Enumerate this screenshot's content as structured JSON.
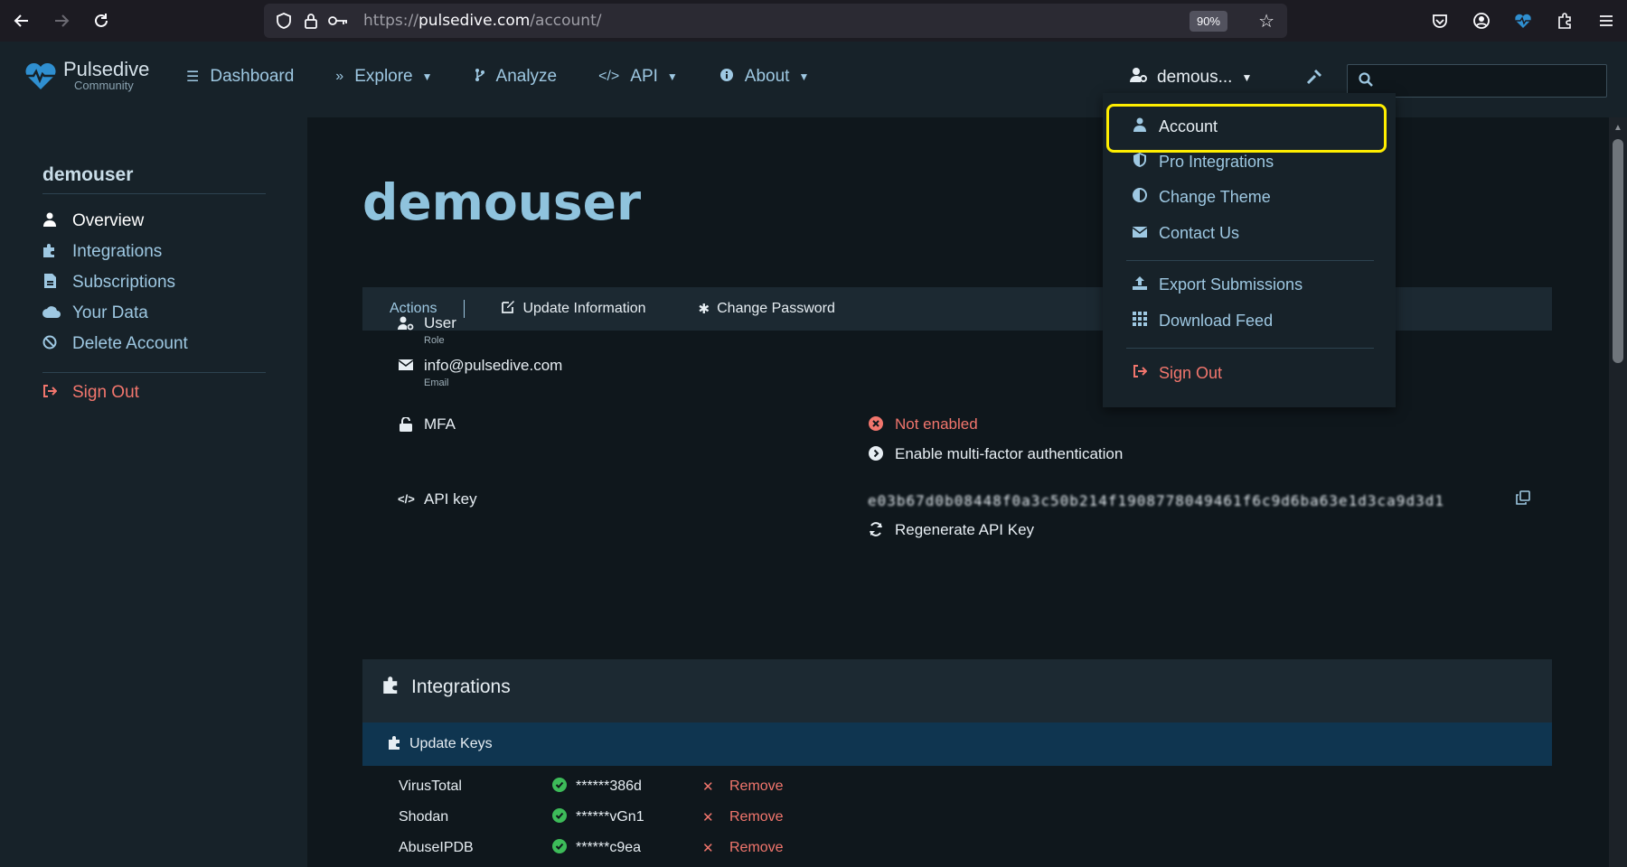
{
  "browser": {
    "url_prefix": "https://",
    "url_host": "pulsedive.com",
    "url_path": "/account/",
    "zoom": "90%"
  },
  "header": {
    "logo_name": "Pulsedive",
    "logo_sub": "Community",
    "nav": [
      {
        "label": "Dashboard"
      },
      {
        "label": "Explore"
      },
      {
        "label": "Analyze"
      },
      {
        "label": "API"
      },
      {
        "label": "About"
      }
    ],
    "user_label": "demous...",
    "search_value": ""
  },
  "sidebar": {
    "username": "demouser",
    "items": [
      {
        "label": "Overview"
      },
      {
        "label": "Integrations"
      },
      {
        "label": "Subscriptions"
      },
      {
        "label": "Your Data"
      },
      {
        "label": "Delete Account"
      }
    ],
    "sign_out": "Sign Out"
  },
  "main": {
    "title": "demouser",
    "actions": {
      "label": "Actions",
      "update_info": "Update Information",
      "change_password": "Change Password"
    },
    "role": {
      "value": "User",
      "label": "Role"
    },
    "email": {
      "value": "info@pulsedive.com",
      "label": "Email"
    },
    "mfa": {
      "label": "MFA",
      "status": "Not enabled",
      "enable_link": "Enable multi-factor authentication"
    },
    "api": {
      "label": "API key",
      "key_masked": "e03b67d0b08448f0a3c50b214f1908778049461f6c9d6ba63e1d3ca9d3d1",
      "regenerate": "Regenerate API Key"
    },
    "integrations": {
      "title": "Integrations",
      "update_keys": "Update Keys",
      "rows": [
        {
          "name": "VirusTotal",
          "key": "******386d",
          "remove": "Remove"
        },
        {
          "name": "Shodan",
          "key": "******vGn1",
          "remove": "Remove"
        },
        {
          "name": "AbuseIPDB",
          "key": "******c9ea",
          "remove": "Remove"
        }
      ]
    }
  },
  "dropdown": {
    "items": [
      {
        "label": "Account"
      },
      {
        "label": "Pro Integrations"
      },
      {
        "label": "Change Theme"
      },
      {
        "label": "Contact Us"
      },
      {
        "label": "Export Submissions"
      },
      {
        "label": "Download Feed"
      },
      {
        "label": "Sign Out"
      }
    ]
  },
  "colors": {
    "accent": "#9ec8e2",
    "danger": "#f2766d",
    "success": "#3dbb59",
    "highlight": "#ffee00"
  }
}
